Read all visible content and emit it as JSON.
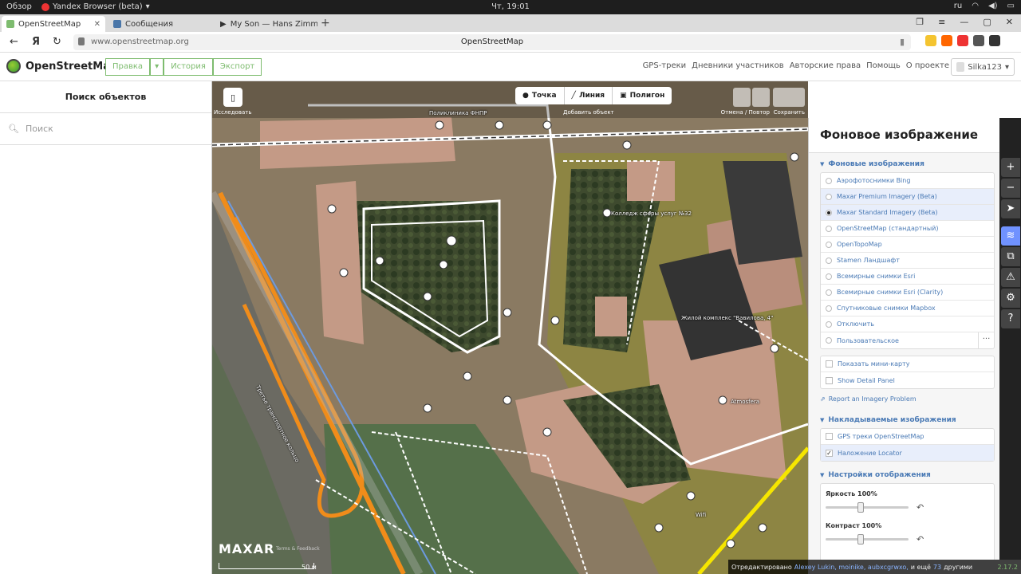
{
  "os": {
    "activities": "Обзор",
    "app_name": "Yandex Browser (beta)",
    "clock": "Чт, 19:01",
    "lang": "ru"
  },
  "tabs": [
    {
      "label": "OpenStreetMap",
      "color": "#7ebc6f"
    },
    {
      "label": "Сообщения",
      "color": "#4a76a8"
    },
    {
      "label": "My Son — Hans Zimm",
      "color": "#333333"
    }
  ],
  "address": {
    "url": "www.openstreetmap.org",
    "page_title": "OpenStreetMap"
  },
  "osm": {
    "logo_text": "OpenStreetMap",
    "edit_label": "Правка",
    "history_label": "История",
    "export_label": "Экспорт",
    "links": [
      "GPS-треки",
      "Дневники участников",
      "Авторские права",
      "Помощь",
      "О проекте"
    ],
    "user": "Silka123"
  },
  "sidebar": {
    "title": "Поиск объектов",
    "search_placeholder": "Поиск"
  },
  "map": {
    "sidebar_toggle_label": "Исследовать",
    "modes": {
      "point": "Точка",
      "line": "Линия",
      "area": "Полигон"
    },
    "add_feature_label": "Добавить объект",
    "undo_redo_label": "Отмена / Повтор",
    "save_label": "Сохранить",
    "labels": {
      "clinic": "Поликлиника ФНПР",
      "college": "Колледж сферы услуг №32",
      "residential": "Жилой комплекс \"Вавилова, 4\"",
      "road": "Третье транспортное кольцо",
      "shop": "Atmosfera",
      "wifi": "Wifi"
    },
    "provider": "MAXAR",
    "terms": "Terms & Feedback",
    "scale": "50 м"
  },
  "footer": {
    "edited_by": "Отредактировано",
    "users": "Alexey Lukin, moinike, aubxcgrwxo,",
    "and_more": "и ещё",
    "count": "73",
    "others": "другими",
    "version": "2.17.2"
  },
  "panel": {
    "title": "Фоновое изображение",
    "bg_section": "Фоновые изображения",
    "bg_layers": [
      {
        "label": "Аэрофотоснимки Bing",
        "selected": false
      },
      {
        "label": "Maxar Premium Imagery (Beta)",
        "selected": false
      },
      {
        "label": "Maxar Standard Imagery (Beta)",
        "selected": true
      },
      {
        "label": "OpenStreetMap (стандартный)",
        "selected": false
      },
      {
        "label": "OpenTopoMap",
        "selected": false
      },
      {
        "label": "Stamen Ландшафт",
        "selected": false
      },
      {
        "label": "Всемирные снимки Esri",
        "selected": false
      },
      {
        "label": "Всемирные снимки Esri (Clarity)",
        "selected": false
      },
      {
        "label": "Спутниковые снимки Mapbox",
        "selected": false
      },
      {
        "label": "Отключить",
        "selected": false
      },
      {
        "label": "Пользовательское",
        "selected": false
      }
    ],
    "minimap": "Показать мини-карту",
    "detail_panel": "Show Detail Panel",
    "report": "Report an Imagery Problem",
    "overlay_section": "Накладываемые изображения",
    "overlays": [
      {
        "label": "GPS треки OpenStreetMap",
        "checked": false
      },
      {
        "label": "Наложение Locator",
        "checked": true
      }
    ],
    "display_section": "Настройки отображения",
    "brightness": "Яркость",
    "brightness_value": "100%",
    "contrast": "Контраст",
    "contrast_value": "100%"
  },
  "colors": {
    "osm_green": "#7ebc6f",
    "link_blue": "#4a7ab5",
    "active_control": "#7092ff"
  }
}
